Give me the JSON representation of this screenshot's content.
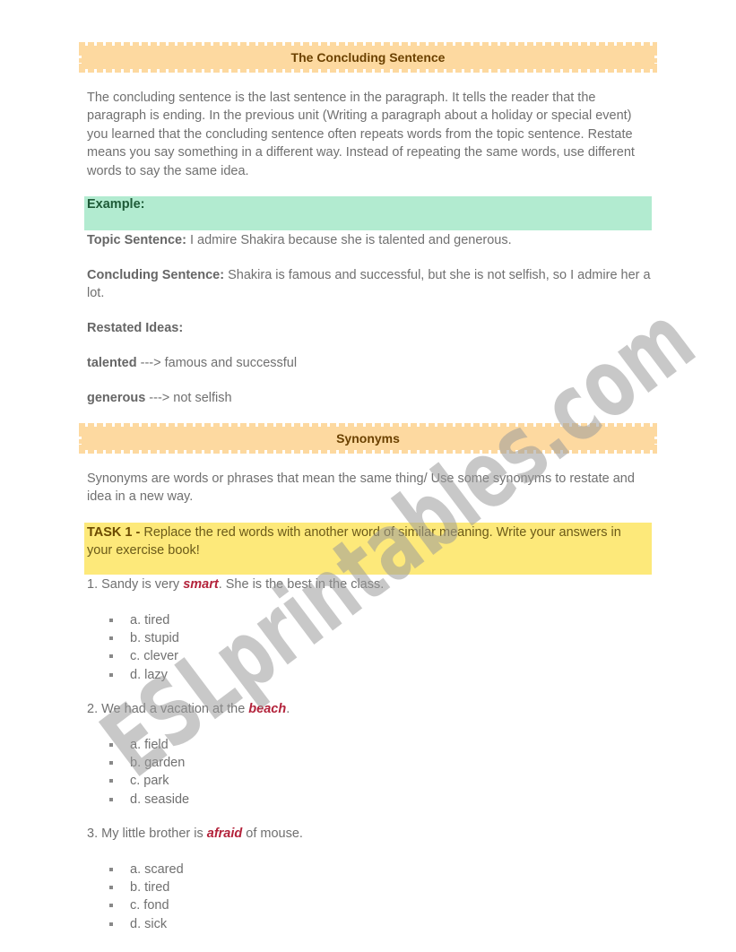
{
  "section1": {
    "title": "The Concluding Sentence",
    "intro": "The concluding sentence is the last sentence in the paragraph. It tells the reader that the paragraph is ending. In the previous unit (Writing a paragraph about a holiday or special event) you learned that the concluding sentence often repeats words from the topic sentence. Restate means you say something in a different way. Instead of repeating the same words, use different words to say the same idea.",
    "example_label": "Example:",
    "topic_label": "Topic Sentence:",
    "topic_text": " I admire Shakira because she is talented and generous.",
    "concluding_label": "Concluding Sentence:",
    "concluding_text": " Shakira is famous and successful, but she is not selfish, so I admire her a lot.",
    "restated_label": "Restated Ideas:",
    "restated": [
      {
        "word": "talented",
        "text": " ---> famous and successful"
      },
      {
        "word": "generous",
        "text": " ---> not selfish"
      }
    ]
  },
  "section2": {
    "title": "Synonyms",
    "intro": "Synonyms are words or phrases that mean the same thing/ Use some synonyms to restate and idea in a new way.",
    "task_label": "TASK 1 -",
    "task_text": " Replace the red words with another word of similar meaning. Write your answers in your exercise book!",
    "questions": [
      {
        "before": "1. Sandy is very ",
        "red": "smart",
        "after": ". She is the best in the class.",
        "options": [
          "a. tired",
          " b. stupid",
          "c. clever",
          "d. lazy"
        ]
      },
      {
        "before": "2. We had a vacation at the ",
        "red": "beach",
        "after": ".",
        "options": [
          "a. field",
          "b. garden",
          "c. park",
          "d. seaside"
        ]
      },
      {
        "before": "3. My little brother is ",
        "red": "afraid",
        "after": " of mouse.",
        "options": [
          "a. scared",
          "b. tired",
          "c. fond",
          "d. sick"
        ]
      }
    ]
  },
  "watermark": "ESLprintables.com",
  "colors": {
    "banner": "#fdd9a0",
    "example_box": "#b2ebd0",
    "task_box": "#fde97a",
    "red_word": "#b3233b"
  }
}
